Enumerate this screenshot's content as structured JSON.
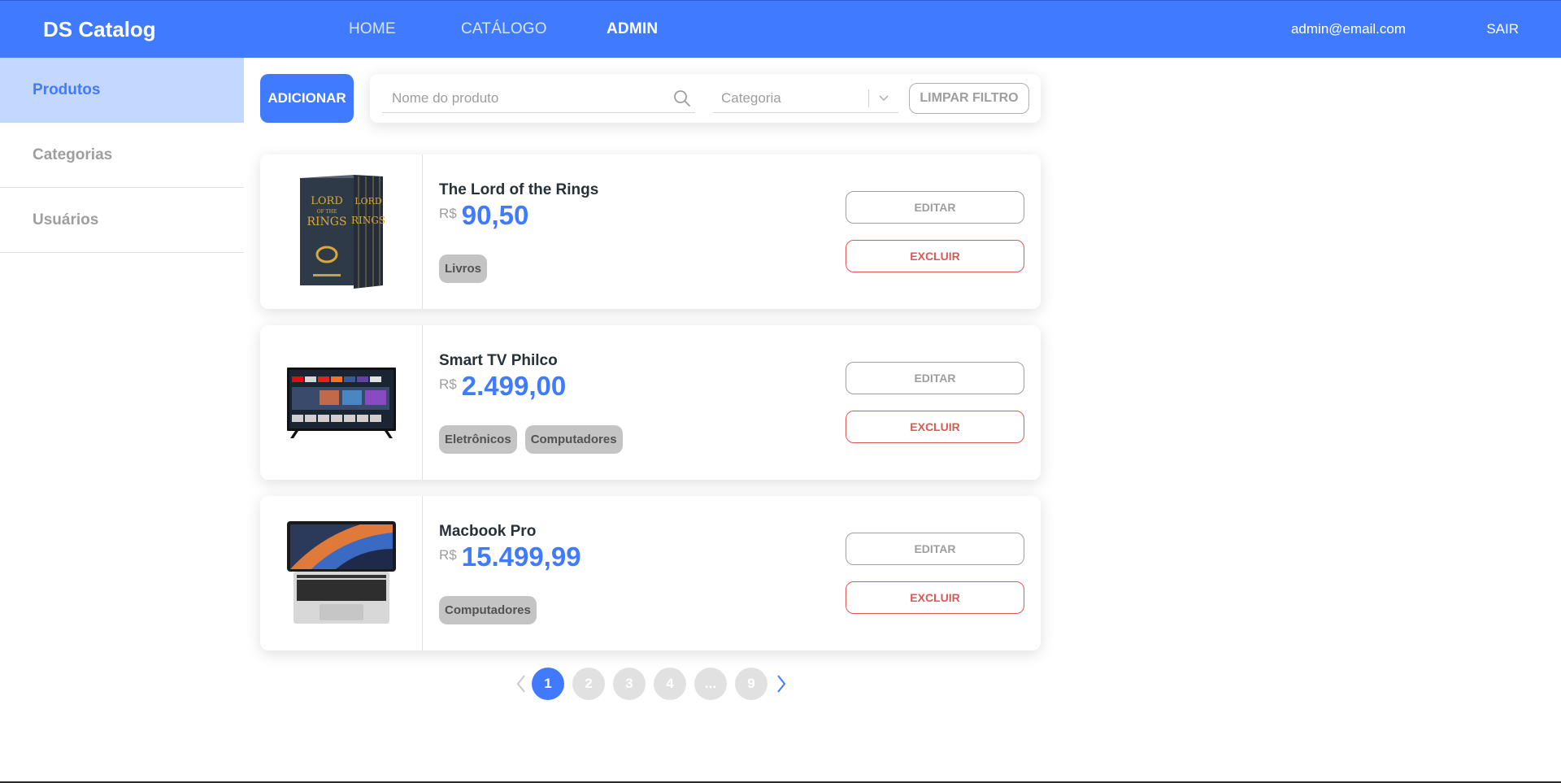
{
  "navbar": {
    "brand": "DS Catalog",
    "links": [
      "HOME",
      "CATÁLOGO",
      "ADMIN"
    ],
    "active_link": "ADMIN",
    "user_email": "admin@email.com",
    "logout_label": "SAIR"
  },
  "sidebar": {
    "items": [
      {
        "label": "Produtos",
        "active": true
      },
      {
        "label": "Categorias",
        "active": false
      },
      {
        "label": "Usuários",
        "active": false
      }
    ]
  },
  "toolbar": {
    "add_label": "ADICIONAR",
    "search_placeholder": "Nome do produto",
    "category_placeholder": "Categoria",
    "clear_label": "LIMPAR FILTRO"
  },
  "products": [
    {
      "name": "The Lord of the Rings",
      "currency": "R$",
      "price": "90,50",
      "categories": [
        "Livros"
      ],
      "image": "book-box-set"
    },
    {
      "name": "Smart TV Philco",
      "currency": "R$",
      "price": "2.499,00",
      "categories": [
        "Eletrônicos",
        "Computadores"
      ],
      "image": "smart-tv"
    },
    {
      "name": "Macbook Pro",
      "currency": "R$",
      "price": "15.499,99",
      "categories": [
        "Computadores"
      ],
      "image": "laptop"
    }
  ],
  "product_actions": {
    "edit_label": "EDITAR",
    "delete_label": "EXCLUIR"
  },
  "pagination": {
    "pages": [
      "1",
      "2",
      "3",
      "4",
      "...",
      "9"
    ],
    "current": "1"
  },
  "colors": {
    "primary": "#407bff",
    "sidebar_active_bg": "#c4d7ff",
    "danger": "#df5753",
    "muted": "#9e9e9e",
    "badge_bg": "#c4c4c4"
  }
}
